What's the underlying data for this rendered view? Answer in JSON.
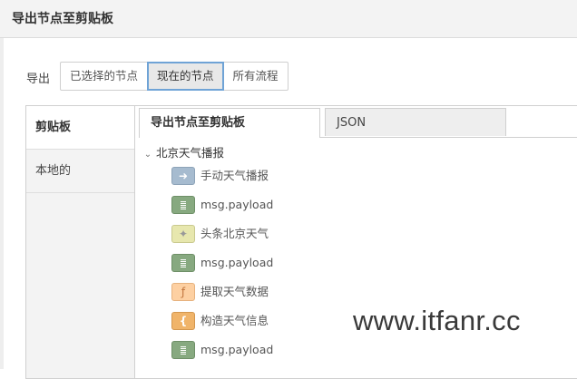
{
  "dialog": {
    "title": "导出节点至剪贴板"
  },
  "export": {
    "label": "导出",
    "options": [
      "已选择的节点",
      "现在的节点",
      "所有流程"
    ],
    "selected": "现在的节点"
  },
  "sidebar": {
    "items": [
      {
        "label": "剪贴板",
        "active": true
      },
      {
        "label": "本地的",
        "active": false
      }
    ]
  },
  "tabs": [
    {
      "label": "导出节点至剪贴板",
      "active": true
    },
    {
      "label": "JSON",
      "active": false
    }
  ],
  "tree": {
    "flow": {
      "label": "北京天气播报",
      "expanded": true
    },
    "nodes": [
      {
        "type": "inject-icon",
        "label": "手动天气播报",
        "color": "#a6bbcf"
      },
      {
        "type": "debug-icon",
        "label": "msg.payload",
        "color": "#87a980"
      },
      {
        "type": "http-request-icon",
        "label": "头条北京天气",
        "color": "#e7e7ae"
      },
      {
        "type": "debug-icon",
        "label": "msg.payload",
        "color": "#87a980"
      },
      {
        "type": "function-icon",
        "label": "提取天气数据",
        "color": "#fdd0a2"
      },
      {
        "type": "template-icon",
        "label": "构造天气信息",
        "color": "#f0b46a"
      },
      {
        "type": "debug-icon",
        "label": "msg.payload",
        "color": "#87a980"
      }
    ]
  },
  "watermark": "www.itfanr.cc"
}
